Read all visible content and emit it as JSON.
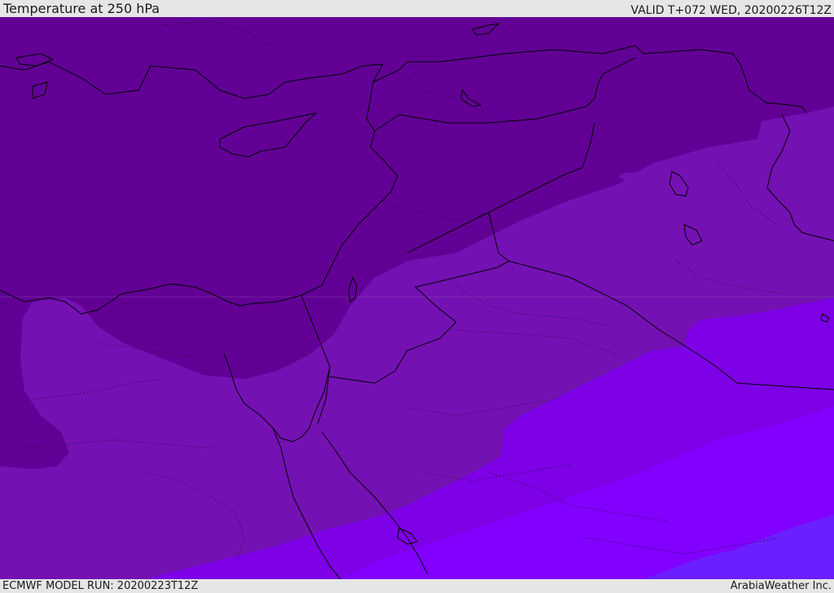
{
  "header": {
    "title": "Temperature at 250 hPa",
    "valid_time": "VALID T+072 WED, 20200226T12Z"
  },
  "footer": {
    "model_run": "ECMWF MODEL RUN: 20200223T12Z",
    "credit": "ArabiaWeather Inc."
  },
  "map": {
    "region": "Eastern Mediterranean / Middle East",
    "parameter": "temperature",
    "level": "250 hPa",
    "shading_colors": [
      "#620095",
      "#7411b3",
      "#7d00e6",
      "#8100ff",
      "#6b1fff"
    ],
    "coastline_color": "#000000"
  }
}
